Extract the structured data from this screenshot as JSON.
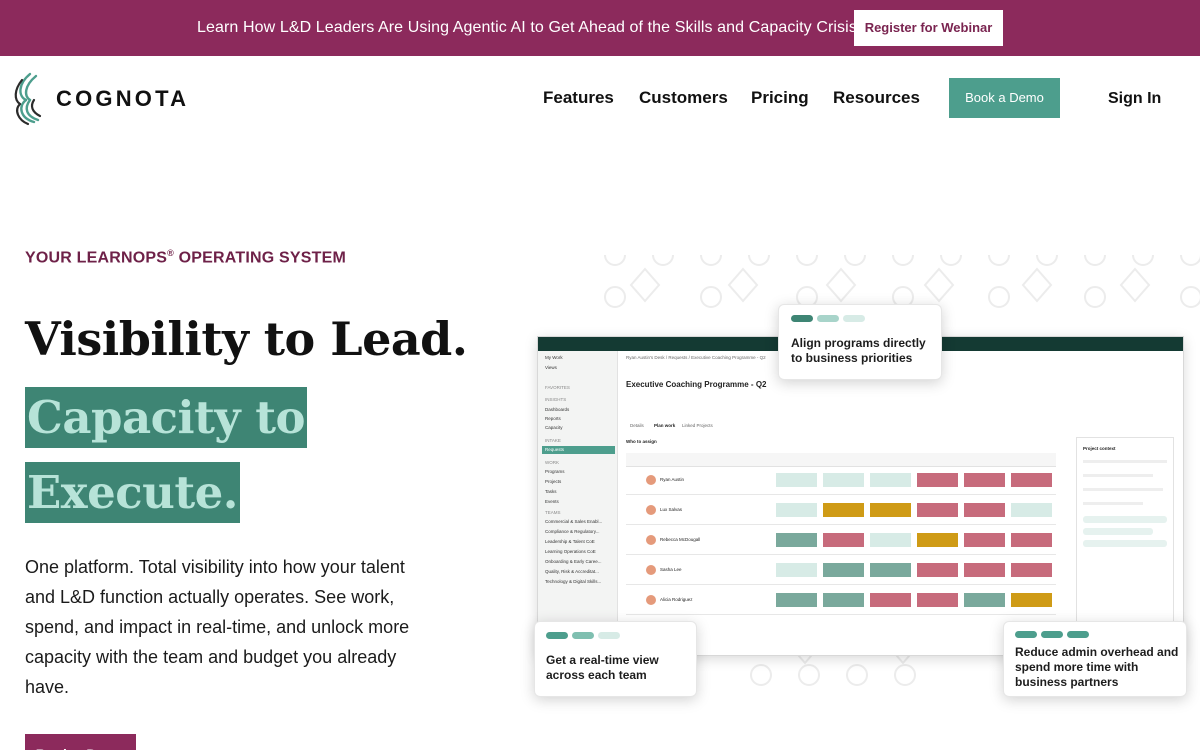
{
  "banner": {
    "text": "Learn How L&D Leaders Are Using Agentic AI to Get Ahead of the Skills and Capacity Crisis",
    "button": "Register for Webinar"
  },
  "header": {
    "logo_text": "COGNOTA",
    "nav": [
      "Features",
      "Customers",
      "Pricing",
      "Resources"
    ],
    "demo_button": "Book a Demo",
    "sign_in": "Sign In"
  },
  "hero": {
    "eyebrow": "YOUR LEARNOPS",
    "eyebrow_reg": "®",
    "eyebrow_rest": " OPERATING SYSTEM",
    "headline": "Visibility to Lead.",
    "highlight_1": "Capacity to",
    "highlight_2": "Execute.",
    "paragraph": "One platform. Total visibility into how your talent and L&D function actually operates. See work, spend, and impact in real-time, and unlock more capacity with the team and budget you already have.",
    "cta": "Book a Demo"
  },
  "mock": {
    "sidebar": [
      "My Work",
      "Views",
      "FAVORITES",
      "INSIGHTS",
      "Dashboards",
      "Reports",
      "Capacity",
      "INTAKE",
      "Requests",
      "WORK",
      "Programs",
      "Projects",
      "Tasks",
      "Events",
      "TEAMS",
      "Commercial & Sales Enabl...",
      "Compliance & Regulatory...",
      "Leadership & Talent CoE",
      "Learning Operations CoE",
      "Onboarding & Early Caree...",
      "Quality, Risk & Accreditat...",
      "Technology & Digital Skills..."
    ],
    "breadcrumb": "Ryan Austin's Desk / Requests / Executive Coaching Programme - Q2",
    "title": "Executive Coaching Programme - Q2",
    "tabs": [
      "Details",
      "Plan work",
      "Linked Projects"
    ],
    "who_to_assign": "Who to assign",
    "people": [
      "Ryan Austin",
      "Lux Salvas",
      "Rebecca McDougall",
      "Sasha Lee",
      "Alicia Rodriguez"
    ],
    "context_title": "Project context"
  },
  "callouts": {
    "top": "Align programs directly to business priorities",
    "bottom_left": "Get a real-time view across each team",
    "bottom_right": "Reduce admin overhead and spend more time with business partners"
  },
  "colors": {
    "banner": "#8c2a5c",
    "teal": "#4d9e8d",
    "highlight_bg": "#3e8574",
    "highlight_text": "#b7e3d8",
    "eyebrow": "#6e2148",
    "bar_pink": "#c76b7c",
    "bar_gold": "#cf9b16",
    "bar_green": "#7aa99c",
    "bar_light": "#d7ebe6"
  }
}
